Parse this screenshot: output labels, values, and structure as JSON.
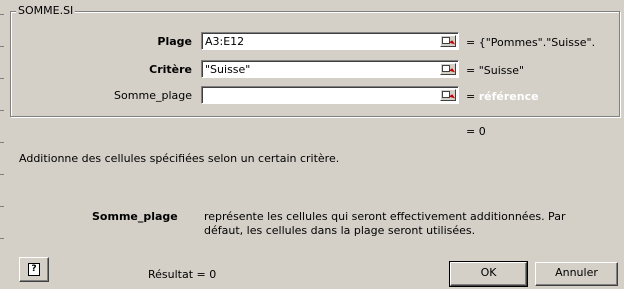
{
  "dialog": {
    "function_name": "SOMME.SI"
  },
  "arguments": [
    {
      "label": "Plage",
      "value": "A3:E12",
      "result": "{\"Pommes\".\"Suisse\"."
    },
    {
      "label": "Critère",
      "value": "\"Suisse\"",
      "result": "\"Suisse\""
    },
    {
      "label": "Somme_plage",
      "value": "",
      "result": "référence"
    }
  ],
  "equals": "=",
  "formula_result": "= 0",
  "description": "Additionne des cellules spécifiées selon un certain critère.",
  "help": {
    "term": "Somme_plage",
    "text": "représente les cellules qui seront effectivement additionnées. Par défaut, les cellules dans la plage seront utilisées."
  },
  "footer": {
    "help_icon": "?",
    "result_label": "Résultat = 0",
    "ok_label": "OK",
    "cancel_label": "Annuler"
  },
  "colors": {
    "dialog_bg": "#d4d0c8",
    "placeholder_text": "#ffffff",
    "collapse_arrow": "#c00000"
  },
  "icons": {
    "collapse": "collapse-dialog-icon",
    "help": "help-icon"
  }
}
